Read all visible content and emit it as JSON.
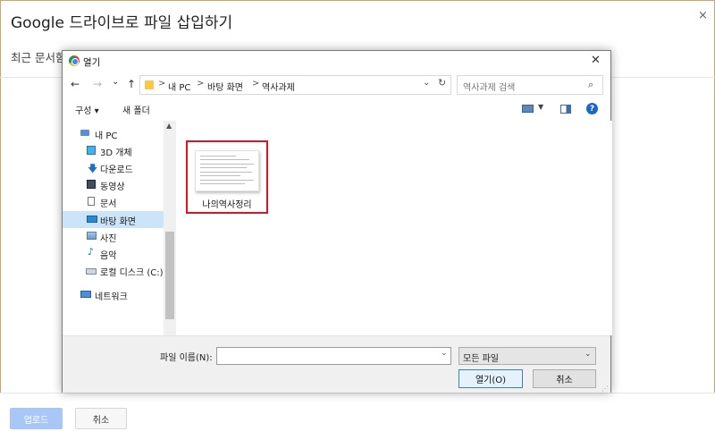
{
  "drive_dialog": {
    "title": "Google 드라이브로 파일 삽입하기",
    "close_glyph": "×",
    "tab_label": "최근 문서함",
    "upload_label": "업로드",
    "cancel_label": "취소",
    "upload_color": "#a8c7f7"
  },
  "open_dialog": {
    "title": "열기",
    "close_glyph": "✕",
    "nav": {
      "back": "←",
      "forward": "→",
      "recent": "⌄",
      "up": "↑"
    },
    "breadcrumb": [
      "내 PC",
      "바탕 화면",
      "역사과제"
    ],
    "breadcrumb_sep": ">",
    "refresh_glyph": "↻",
    "search_placeholder": "역사과제 검색",
    "search_icon": "⌕",
    "toolbar": {
      "organize_label": "구성 ▾",
      "new_folder_label": "새 폴더",
      "help_label": "?"
    },
    "nav_pane": [
      {
        "label": "내 PC",
        "icon": "pc-icon",
        "selected": false
      },
      {
        "label": "3D 개체",
        "icon": "cube-icon",
        "selected": false
      },
      {
        "label": "다운로드",
        "icon": "download-icon",
        "selected": false
      },
      {
        "label": "동영상",
        "icon": "video-icon",
        "selected": false
      },
      {
        "label": "문서",
        "icon": "document-icon",
        "selected": false
      },
      {
        "label": "바탕 화면",
        "icon": "desktop-icon",
        "selected": true
      },
      {
        "label": "사진",
        "icon": "picture-icon",
        "selected": false
      },
      {
        "label": "음악",
        "icon": "music-icon",
        "selected": false
      },
      {
        "label": "로컬 디스크 (C:)",
        "icon": "disk-icon",
        "selected": false
      },
      {
        "label": "네트워크",
        "icon": "network-icon",
        "selected": false
      }
    ],
    "files": [
      {
        "name": "나의역사정리",
        "highlighted": true,
        "highlight_color": "#e0141e"
      }
    ],
    "filename_label": "파일 이름(N):",
    "filename_value": "",
    "filetype_value": "모든 파일",
    "open_button": "열기(O)",
    "cancel_button": "취소",
    "selected_color": "#cce4f7"
  }
}
